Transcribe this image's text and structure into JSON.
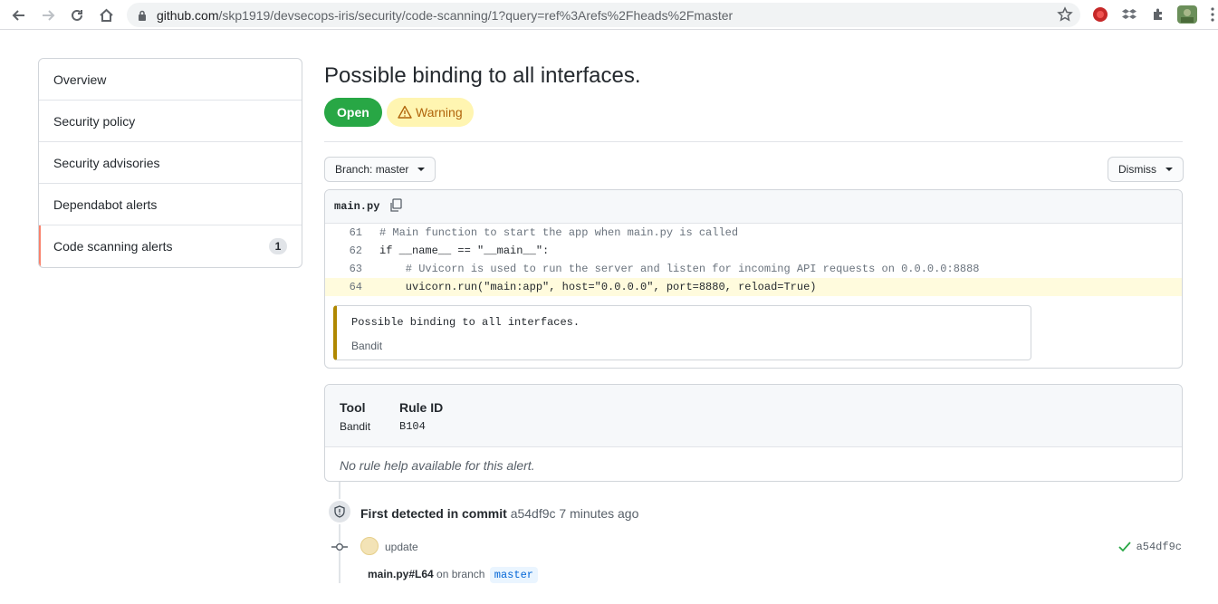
{
  "browser": {
    "url_host": "github.com",
    "url_path": "/skp1919/devsecops-iris/security/code-scanning/1?query=ref%3Arefs%2Fheads%2Fmaster"
  },
  "sidebar": {
    "items": [
      {
        "label": "Overview"
      },
      {
        "label": "Security policy"
      },
      {
        "label": "Security advisories"
      },
      {
        "label": "Dependabot alerts"
      },
      {
        "label": "Code scanning alerts",
        "count": "1",
        "active": true
      }
    ]
  },
  "alert": {
    "title": "Possible binding to all interfaces.",
    "state": "Open",
    "severity": "Warning",
    "branch_label": "Branch: master",
    "dismiss_label": "Dismiss"
  },
  "code": {
    "filename": "main.py",
    "lines": [
      {
        "num": "61",
        "text": "# Main function to start the app when main.py is called"
      },
      {
        "num": "62",
        "text": "if __name__ == \"__main__\":"
      },
      {
        "num": "63",
        "text": "    # Uvicorn is used to run the server and listen for incoming API requests on 0.0.0.0:8888"
      },
      {
        "num": "64",
        "text": "    uvicorn.run(\"main:app\", host=\"0.0.0.0\", port=8880, reload=True)"
      }
    ],
    "message": "Possible binding to all interfaces.",
    "message_tool": "Bandit"
  },
  "info": {
    "tool_header": "Tool",
    "tool_value": "Bandit",
    "rule_header": "Rule ID",
    "rule_value": "B104",
    "help_text": "No rule help available for this alert."
  },
  "timeline": {
    "detected_prefix": "First detected in commit",
    "commit_sha": "a54df9c",
    "time_ago": "7 minutes ago",
    "commit_message": "update",
    "commit_sha_right": "a54df9c",
    "location_file": "main.py#L64",
    "location_mid": "on branch",
    "location_branch": "master"
  },
  "colors": {
    "open_green": "#28a745",
    "warning_bg": "#fff5b1",
    "active_accent": "#f9826c",
    "highlight_line": "#fffbdd"
  }
}
